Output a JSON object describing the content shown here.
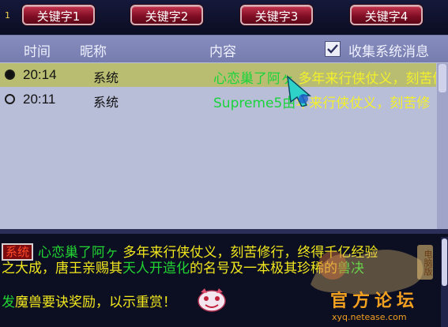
{
  "top_index": "1",
  "keyword_buttons": [
    {
      "label": "关键字1"
    },
    {
      "label": "关键字2"
    },
    {
      "label": "关键字3"
    },
    {
      "label": "关键字4"
    }
  ],
  "header": {
    "time": "时间",
    "nickname": "昵称",
    "content": "内容",
    "collect_label": "收集系统消息",
    "collect_checked": true
  },
  "rows": [
    {
      "selected": true,
      "time": "20:14",
      "nickname": "系统",
      "content_name": "心恋巢了阿ヶ",
      "content_text": "多年来行侠仗义，刻苦修"
    },
    {
      "selected": false,
      "time": "20:11",
      "nickname": "系统",
      "content_name": "Supreme",
      "content_text": "5由",
      "content_tail": "年来行侠仗义，刻苦修"
    }
  ],
  "chat": {
    "tag": "系统",
    "line1_name": "心恋巢了阿ヶ",
    "line1_text": "多年来行侠仗义，刻苦修行，终得千亿经验",
    "line2_text_a": "之大成，唐王亲赐其",
    "line2_title": "天人开造化",
    "line2_text_b": "的名号及一本极其珍稀的",
    "line2_item": "兽决",
    "line3_item": "发",
    "line3_text": "魔兽要诀奖励，以示重赏！"
  },
  "watermark": {
    "badge": "电脑版",
    "title": "官方论坛",
    "url": "xyq.netease.com"
  },
  "colors": {
    "button_red": "#7d0c22",
    "list_bg": "#b8bdd8",
    "header_bg": "#767cae",
    "selected_row": "#b9bd72",
    "name_green": "#19d43a",
    "text_yellow": "#f2f02c"
  }
}
